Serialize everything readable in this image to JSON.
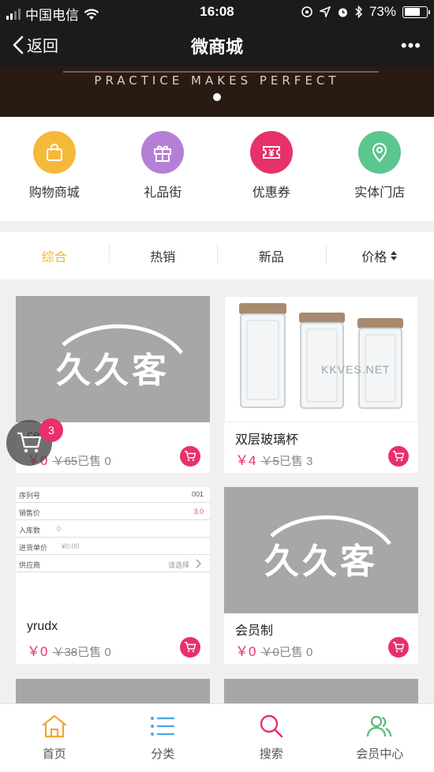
{
  "status_bar": {
    "carrier": "中国电信",
    "time": "16:08",
    "battery": "73%"
  },
  "nav": {
    "back_label": "返回",
    "title": "微商城",
    "more_label": "•••"
  },
  "banner": {
    "slogan": "PRACTICE MAKES PERFECT"
  },
  "quick_entries": [
    {
      "label": "购物商城",
      "color": "#f5b93a",
      "icon": "shopping-bag-icon"
    },
    {
      "label": "礼品街",
      "color": "#b57fd6",
      "icon": "gift-icon"
    },
    {
      "label": "优惠券",
      "color": "#e7316a",
      "icon": "coupon-icon"
    },
    {
      "label": "实体门店",
      "color": "#5cc68f",
      "icon": "location-pin-icon"
    }
  ],
  "sort_tabs": [
    {
      "label": "综合",
      "active": true
    },
    {
      "label": "热销"
    },
    {
      "label": "新品"
    },
    {
      "label": "价格",
      "icon": "sort-arrows-icon"
    }
  ],
  "products": [
    {
      "name": "ce",
      "price": "￥0",
      "old_price": "￥65",
      "sold": "已售 0",
      "image": "jiujiuke-logo"
    },
    {
      "name": "双层玻璃杯",
      "price": "￥4",
      "old_price": "￥5",
      "sold": "已售 3",
      "image": "glass-cups-photo",
      "watermark": "KKVES.NET"
    },
    {
      "name": "yrudx",
      "price": "￥0",
      "old_price": "￥38",
      "sold": "已售 0",
      "image": "form-screenshot",
      "form_rows": [
        {
          "label": "序列号",
          "value": "001"
        },
        {
          "label": "销售价",
          "value": "3.0"
        },
        {
          "label": "入库数",
          "value": "0"
        },
        {
          "label": "进货单价",
          "value": "¥0.00"
        },
        {
          "label": "供应商",
          "value": "请选择"
        }
      ]
    },
    {
      "name": "会员制",
      "price": "￥0",
      "old_price": "￥0",
      "sold": "已售 0",
      "image": "jiujiuke-logo"
    }
  ],
  "logo_text": "久久客",
  "floating_cart": {
    "count": "3"
  },
  "tab_bar": [
    {
      "label": "首页",
      "icon": "home-icon",
      "color": "#f0a43a"
    },
    {
      "label": "分类",
      "icon": "list-icon",
      "color": "#48a6e8"
    },
    {
      "label": "搜索",
      "icon": "search-icon",
      "color": "#e7316a"
    },
    {
      "label": "会员中心",
      "icon": "members-icon",
      "color": "#5cb87a"
    }
  ]
}
